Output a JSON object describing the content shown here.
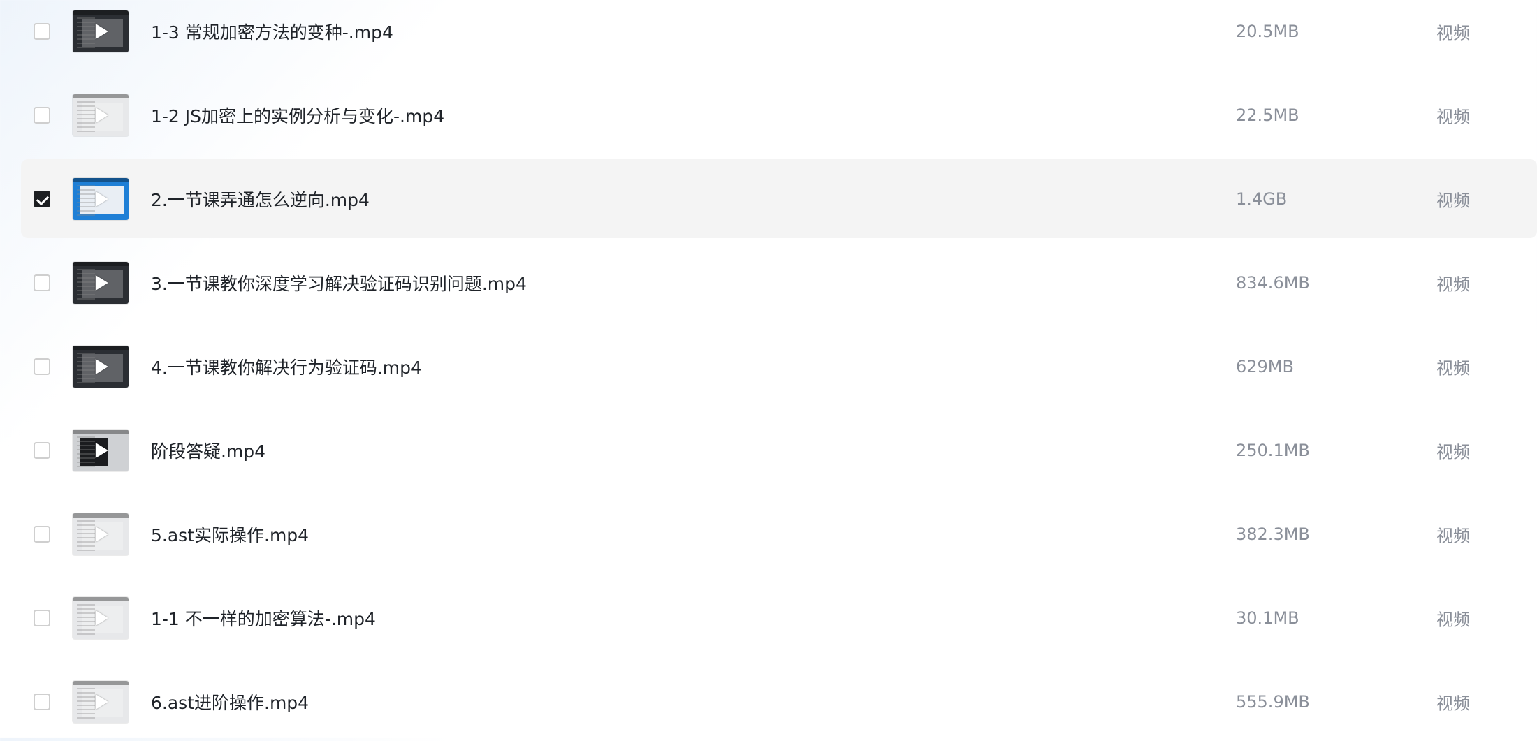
{
  "files": [
    {
      "name": "1-3 常规加密方法的变种-.mp4",
      "size": "20.5MB",
      "type": "视频",
      "checked": false,
      "thumb": "dark"
    },
    {
      "name": "1-2 JS加密上的实例分析与变化-.mp4",
      "size": "22.5MB",
      "type": "视频",
      "checked": false,
      "thumb": "light"
    },
    {
      "name": "2.一节课弄通怎么逆向.mp4",
      "size": "1.4GB",
      "type": "视频",
      "checked": true,
      "thumb": "blue"
    },
    {
      "name": "3.一节课教你深度学习解决验证码识别问题.mp4",
      "size": "834.6MB",
      "type": "视频",
      "checked": false,
      "thumb": "dark"
    },
    {
      "name": "4.一节课教你解决行为验证码.mp4",
      "size": "629MB",
      "type": "视频",
      "checked": false,
      "thumb": "dark"
    },
    {
      "name": "阶段答疑.mp4",
      "size": "250.1MB",
      "type": "视频",
      "checked": false,
      "thumb": "mixed"
    },
    {
      "name": "5.ast实际操作.mp4",
      "size": "382.3MB",
      "type": "视频",
      "checked": false,
      "thumb": "light"
    },
    {
      "name": "1-1 不一样的加密算法-.mp4",
      "size": "30.1MB",
      "type": "视频",
      "checked": false,
      "thumb": "light"
    },
    {
      "name": "6.ast进阶操作.mp4",
      "size": "555.9MB",
      "type": "视频",
      "checked": false,
      "thumb": "light"
    }
  ],
  "icons": {
    "checkbox": "checkbox-icon",
    "play": "play-icon"
  },
  "colors": {
    "selected_row_bg": "#f4f4f4",
    "checked_box": "#1c1e21",
    "meta_text": "#8a8f99"
  }
}
